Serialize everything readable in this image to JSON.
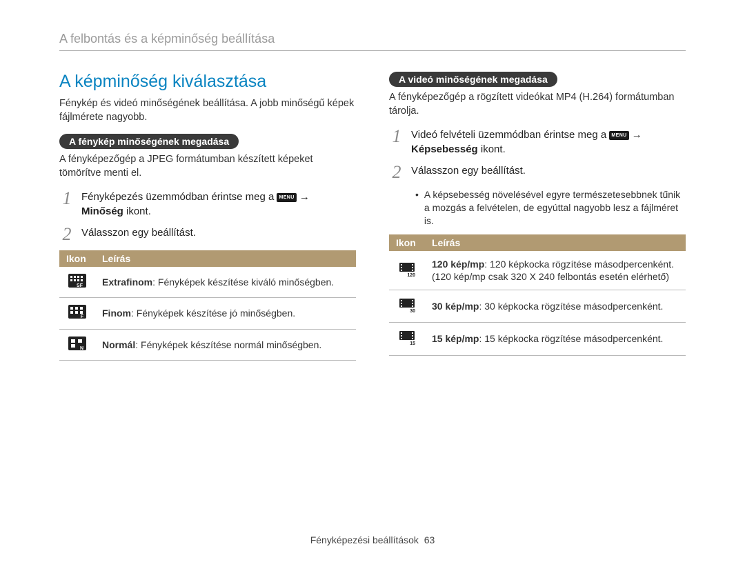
{
  "header": {
    "title": "A felbontás és a képminőség beállítása"
  },
  "left": {
    "section_title": "A képminőség kiválasztása",
    "intro": "Fénykép és videó minőségének beállítása. A jobb minőségű képek fájlmérete nagyobb.",
    "pill": "A fénykép minőségének megadása",
    "pill_sub": "A fényképezőgép a JPEG formátumban készített képeket tömörítve menti el.",
    "step1_num": "1",
    "step1_pre": "Fényképezés üzemmódban érintse meg a ",
    "step1_menu": "MENU",
    "step1_arrow": "→",
    "step1_bold": "Minőség",
    "step1_post": " ikont.",
    "step2_num": "2",
    "step2_text": "Válasszon egy beállítást.",
    "table": {
      "th_icon": "Ikon",
      "th_desc": "Leírás",
      "rows": [
        {
          "icon_sub": "SF",
          "bold": "Extrafinom",
          "rest": ": Fényképek készítése kiváló minőségben."
        },
        {
          "icon_sub": "F",
          "bold": "Finom",
          "rest": ": Fényképek készítése jó minőségben."
        },
        {
          "icon_sub": "N",
          "bold": "Normál",
          "rest": ": Fényképek készítése normál minőségben."
        }
      ]
    }
  },
  "right": {
    "pill": "A videó minőségének megadása",
    "pill_sub": "A fényképezőgép a rögzített videókat MP4 (H.264) formátumban tárolja.",
    "step1_num": "1",
    "step1_pre": "Videó felvételi üzemmódban érintse meg a ",
    "step1_menu": "MENU",
    "step1_arrow": "→",
    "step1_bold": "Képsebesség",
    "step1_post": " ikont.",
    "step2_num": "2",
    "step2_text": "Válasszon egy beállítást.",
    "bullet": "A képsebesség növelésével egyre természetesebbnek tűnik a mozgás a felvételen, de egyúttal nagyobb lesz a fájlméret is.",
    "table": {
      "th_icon": "Ikon",
      "th_desc": "Leírás",
      "rows": [
        {
          "icon_sub": "120",
          "bold": "120 kép/mp",
          "rest": ": 120 képkocka rögzítése másodpercenként.",
          "note": "(120 kép/mp csak 320 X 240 felbontás esetén elérhető)"
        },
        {
          "icon_sub": "30",
          "bold": "30 kép/mp",
          "rest": ": 30 képkocka rögzítése másodpercenként."
        },
        {
          "icon_sub": "15",
          "bold": "15 kép/mp",
          "rest": ": 15 képkocka rögzítése másodpercenként."
        }
      ]
    }
  },
  "footer": {
    "label": "Fényképezési beállítások",
    "page": "63"
  }
}
